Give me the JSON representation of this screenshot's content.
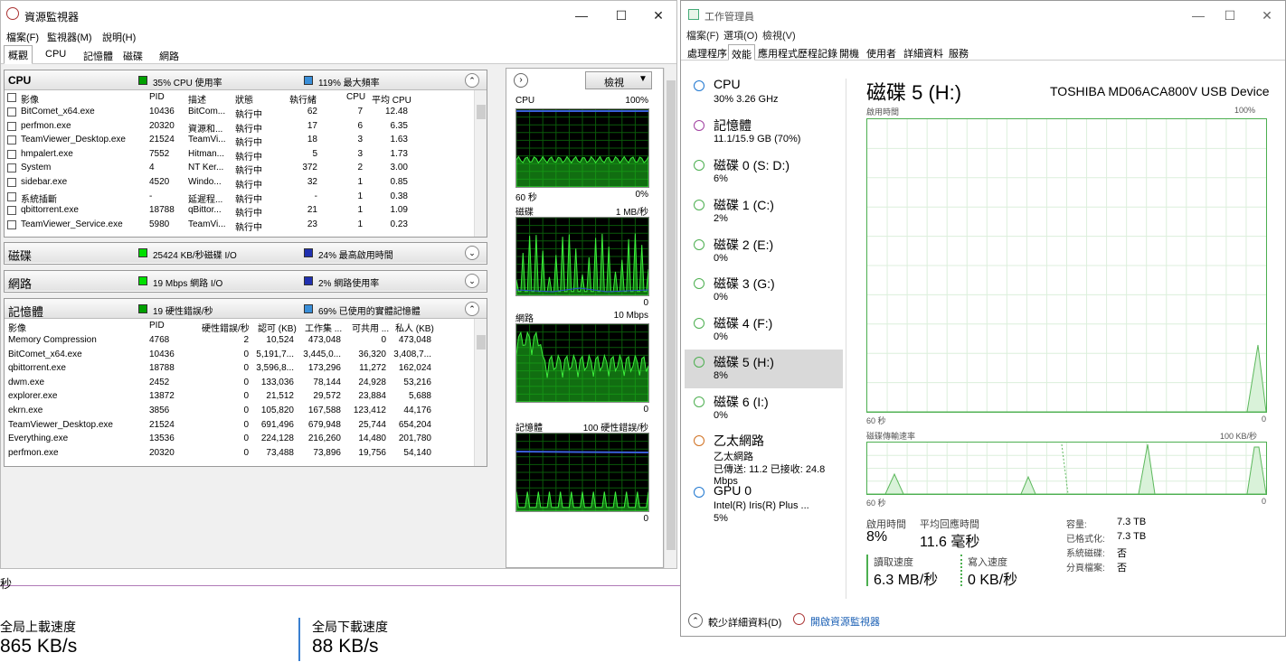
{
  "background_app": {
    "seconds_label": "秒",
    "upload_label": "全局上載速度",
    "upload_value": "865 KB/s",
    "download_label": "全局下載速度",
    "download_value": "88 KB/s"
  },
  "resmon": {
    "title": "資源監視器",
    "menu": [
      "檔案(F)",
      "監視器(M)",
      "說明(H)"
    ],
    "tabs": [
      "概觀",
      "CPU",
      "記憶體",
      "磁碟",
      "網路"
    ],
    "cpu": {
      "title": "CPU",
      "stat1": "35% CPU 使用率",
      "stat2": "119% 最大頻率",
      "stat1_color": "#00a000",
      "stat2_color": "#3a8fd9",
      "headers": [
        "影像",
        "PID",
        "描述",
        "狀態",
        "執行緒",
        "CPU",
        "平均 CPU"
      ],
      "rows": [
        [
          "BitComet_x64.exe",
          "10436",
          "BitCom...",
          "執行中",
          "62",
          "7",
          "12.48"
        ],
        [
          "perfmon.exe",
          "20320",
          "資源和...",
          "執行中",
          "17",
          "6",
          "6.35"
        ],
        [
          "TeamViewer_Desktop.exe",
          "21524",
          "TeamVi...",
          "執行中",
          "18",
          "3",
          "1.63"
        ],
        [
          "hmpalert.exe",
          "7552",
          "Hitman...",
          "執行中",
          "5",
          "3",
          "1.73"
        ],
        [
          "System",
          "4",
          "NT Ker...",
          "執行中",
          "372",
          "2",
          "3.00"
        ],
        [
          "sidebar.exe",
          "4520",
          "Windo...",
          "執行中",
          "32",
          "1",
          "0.85"
        ],
        [
          "系統插斷",
          "-",
          "延遲程...",
          "執行中",
          "-",
          "1",
          "0.38"
        ],
        [
          "qbittorrent.exe",
          "18788",
          "qBittor...",
          "執行中",
          "21",
          "1",
          "1.09"
        ],
        [
          "TeamViewer_Service.exe",
          "5980",
          "TeamVi...",
          "執行中",
          "23",
          "1",
          "0.23"
        ]
      ]
    },
    "disk": {
      "title": "磁碟",
      "stat1": "25424 KB/秒磁碟 I/O",
      "stat2": "24% 最高啟用時間",
      "stat1_color": "#00e000",
      "stat2_color": "#2030b0"
    },
    "network": {
      "title": "網路",
      "stat1": "19 Mbps 網路 I/O",
      "stat2": "2% 網路使用率",
      "stat1_color": "#00e000",
      "stat2_color": "#2030b0"
    },
    "memory": {
      "title": "記憶體",
      "stat1": "19 硬性錯誤/秒",
      "stat2": "69% 已使用的實體記憶體",
      "stat1_color": "#00a000",
      "stat2_color": "#3a8fd9",
      "headers": [
        "影像",
        "PID",
        "硬性錯誤/秒",
        "認可 (KB)",
        "工作集 ...",
        "可共用 ...",
        "私人 (KB)"
      ],
      "rows": [
        [
          "Memory Compression",
          "4768",
          "2",
          "10,524",
          "473,048",
          "0",
          "473,048"
        ],
        [
          "BitComet_x64.exe",
          "10436",
          "0",
          "5,191,7...",
          "3,445,0...",
          "36,320",
          "3,408,7..."
        ],
        [
          "qbittorrent.exe",
          "18788",
          "0",
          "3,596,8...",
          "173,296",
          "11,272",
          "162,024"
        ],
        [
          "dwm.exe",
          "2452",
          "0",
          "133,036",
          "78,144",
          "24,928",
          "53,216"
        ],
        [
          "explorer.exe",
          "13872",
          "0",
          "21,512",
          "29,572",
          "23,884",
          "5,688"
        ],
        [
          "ekrn.exe",
          "3856",
          "0",
          "105,820",
          "167,588",
          "123,412",
          "44,176"
        ],
        [
          "TeamViewer_Desktop.exe",
          "21524",
          "0",
          "691,496",
          "679,948",
          "25,744",
          "654,204"
        ],
        [
          "Everything.exe",
          "13536",
          "0",
          "224,128",
          "216,260",
          "14,480",
          "201,780"
        ],
        [
          "perfmon.exe",
          "20320",
          "0",
          "73,488",
          "73,896",
          "19,756",
          "54,140"
        ]
      ]
    },
    "graph_panel": {
      "view_label": "檢視",
      "graphs": [
        {
          "name": "CPU",
          "max": "100%",
          "bottom_left": "60 秒",
          "bottom_right": "0%"
        },
        {
          "name": "磁碟",
          "max": "1 MB/秒",
          "bottom_left": "",
          "bottom_right": "0"
        },
        {
          "name": "網路",
          "max": "10 Mbps",
          "bottom_left": "",
          "bottom_right": "0"
        },
        {
          "name": "記憶體",
          "max": "100 硬性錯誤/秒",
          "bottom_left": "",
          "bottom_right": "0"
        }
      ]
    }
  },
  "taskmgr": {
    "title": "工作管理員",
    "menu": [
      "檔案(F)",
      "選項(O)",
      "檢視(V)"
    ],
    "tabs": [
      "處理程序",
      "效能",
      "應用程式歷程記錄",
      "開機",
      "使用者",
      "詳細資料",
      "服務"
    ],
    "sidebar": [
      {
        "name": "CPU",
        "sub": "30%  3.26 GHz",
        "color": "#1f77d0"
      },
      {
        "name": "記憶體",
        "sub": "11.1/15.9 GB (70%)",
        "color": "#a040a0"
      },
      {
        "name": "磁碟 0 (S: D:)",
        "sub": "6%",
        "color": "#4caf50"
      },
      {
        "name": "磁碟 1 (C:)",
        "sub": "2%",
        "color": "#4caf50"
      },
      {
        "name": "磁碟 2 (E:)",
        "sub": "0%",
        "color": "#4caf50"
      },
      {
        "name": "磁碟 3 (G:)",
        "sub": "0%",
        "color": "#4caf50"
      },
      {
        "name": "磁碟 4 (F:)",
        "sub": "0%",
        "color": "#4caf50"
      },
      {
        "name": "磁碟 5 (H:)",
        "sub": "8%",
        "color": "#4caf50"
      },
      {
        "name": "磁碟 6 (I:)",
        "sub": "0%",
        "color": "#4caf50"
      },
      {
        "name": "乙太網路",
        "sub": "乙太網路",
        "sub2": "已傳送: 11.2 已接收: 24.8 Mbps",
        "color": "#d07020"
      },
      {
        "name": "GPU 0",
        "sub": "Intel(R) Iris(R) Plus ...",
        "sub2": "5%",
        "color": "#1f77d0"
      }
    ],
    "detail": {
      "title": "磁碟 5 (H:)",
      "device": "TOSHIBA MD06ACA800V USB Device",
      "g1_label": "啟用時間",
      "g1_max": "100%",
      "g1_left": "60 秒",
      "g1_right": "0",
      "g2_label": "磁碟傳輸速率",
      "g2_max": "100 KB/秒",
      "g2_left": "60 秒",
      "g2_right": "0",
      "active_label": "啟用時間",
      "active_value": "8%",
      "resp_label": "平均回應時間",
      "resp_value": "11.6 毫秒",
      "read_label": "讀取速度",
      "read_value": "6.3 MB/秒",
      "write_label": "寫入速度",
      "write_value": "0 KB/秒",
      "cap_label": "容量:",
      "cap_value": "7.3 TB",
      "fmt_label": "已格式化:",
      "fmt_value": "7.3 TB",
      "sys_label": "系統磁碟:",
      "sys_value": "否",
      "page_label": "分頁檔案:",
      "page_value": "否"
    },
    "footer": {
      "fewer": "較少詳細資料(D)",
      "open_resmon": "開啟資源監視器"
    }
  }
}
